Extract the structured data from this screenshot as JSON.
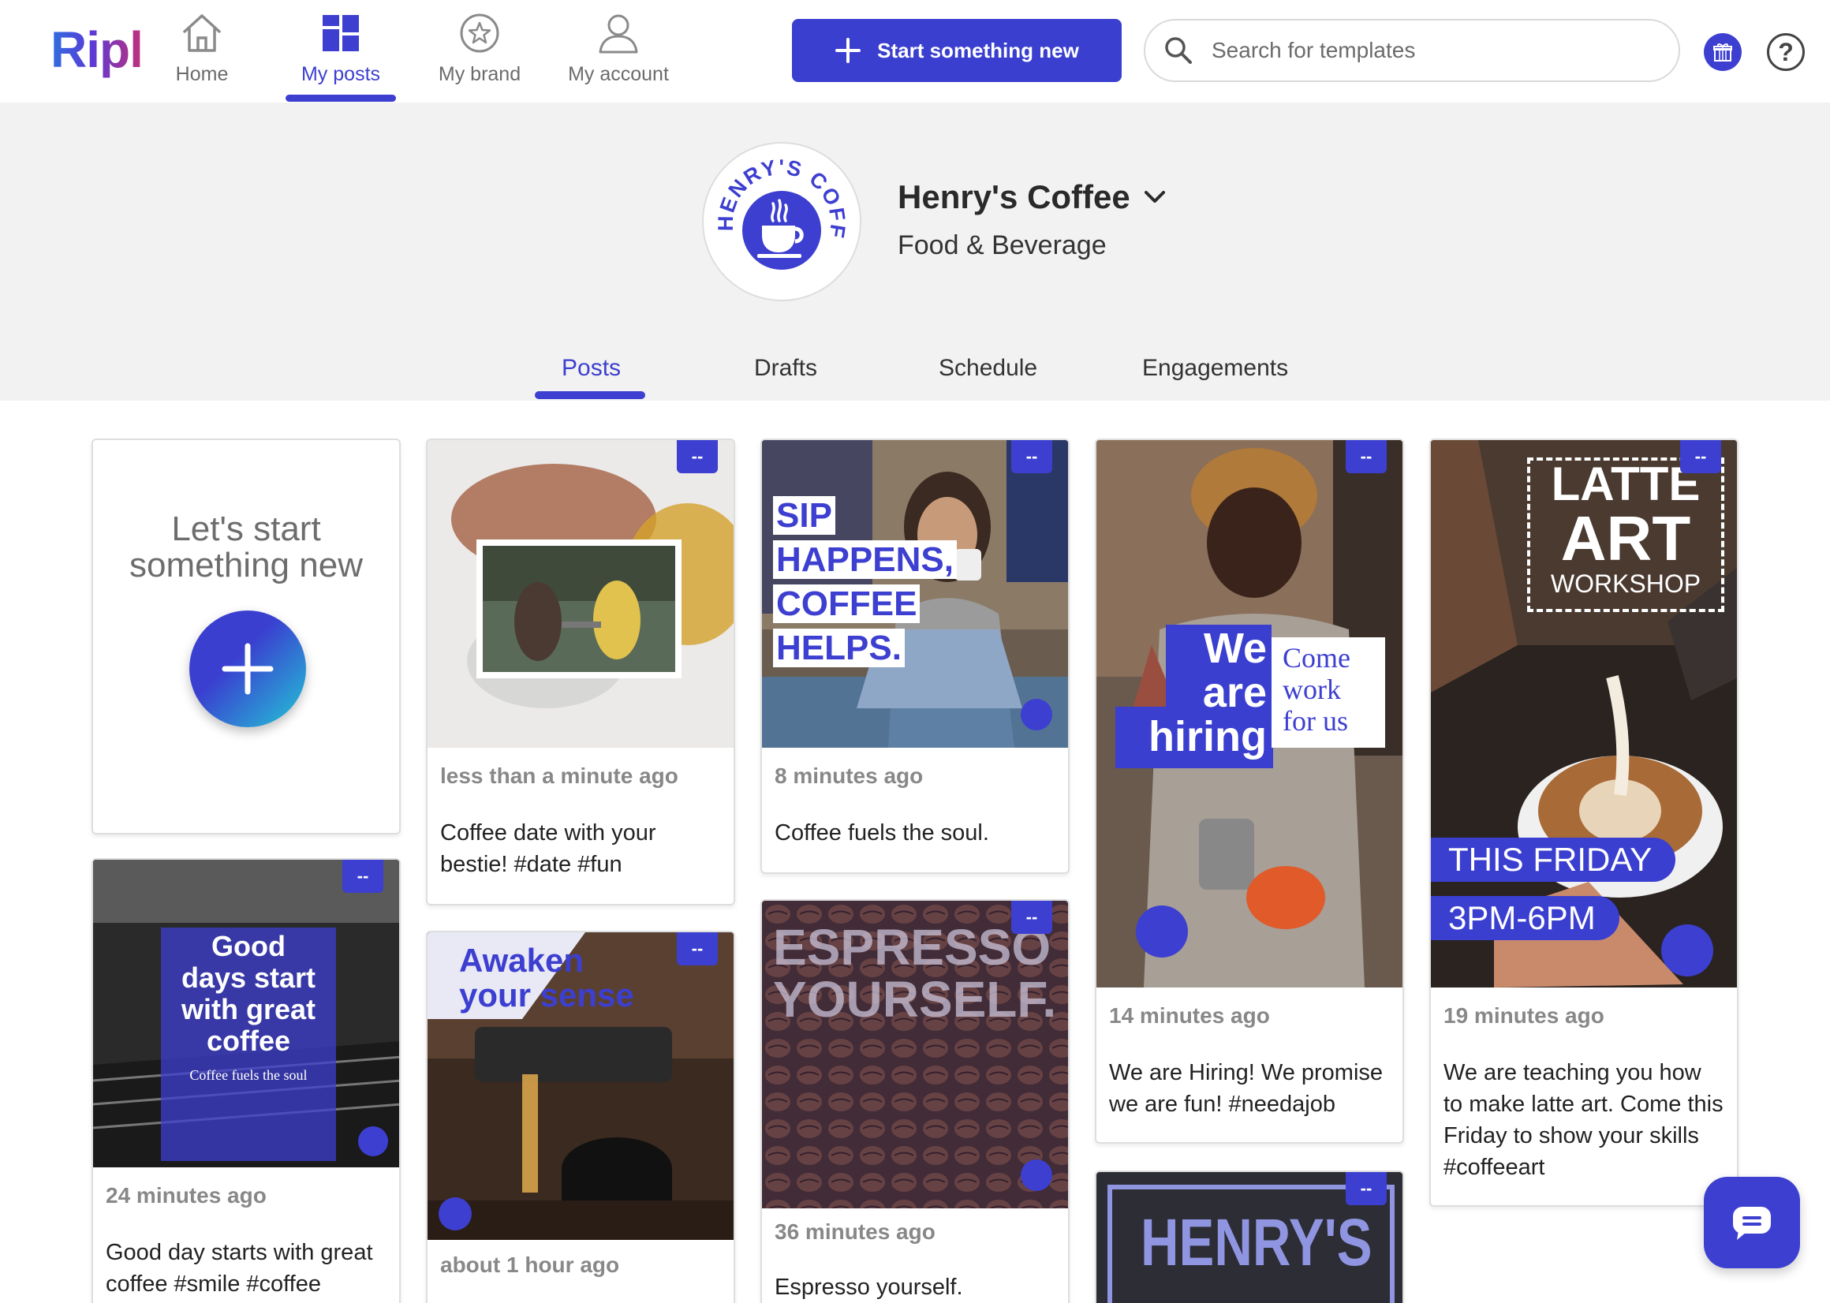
{
  "app": {
    "logo": "Ripl"
  },
  "nav": {
    "items": [
      {
        "label": "Home",
        "icon": "home-icon"
      },
      {
        "label": "My posts",
        "icon": "grid-icon",
        "active": true
      },
      {
        "label": "My brand",
        "icon": "star-icon"
      },
      {
        "label": "My account",
        "icon": "user-icon"
      }
    ],
    "cta_label": "Start something new",
    "search_placeholder": "Search for templates"
  },
  "profile": {
    "name": "Henry's Coffee",
    "category": "Food & Beverage",
    "logo_text": "HENRY'S COFFEE"
  },
  "tabs": [
    {
      "label": "Posts",
      "active": true
    },
    {
      "label": "Drafts"
    },
    {
      "label": "Schedule"
    },
    {
      "label": "Engagements"
    }
  ],
  "start_card": {
    "title_line1": "Let's start",
    "title_line2": "something new"
  },
  "badge": "--",
  "posts": [
    {
      "time": "less than a minute ago",
      "caption": "Coffee date with your bestie! #date #fun"
    },
    {
      "time": "8 minutes ago",
      "caption": "Coffee fuels the soul.",
      "overlay": [
        "SIP",
        "HAPPENS,",
        "COFFEE",
        "HELPS."
      ]
    },
    {
      "time": "14 minutes ago",
      "caption": "We are Hiring! We promise we are fun! #needajob",
      "overlay_left": [
        "We",
        "are",
        "hiring"
      ],
      "overlay_right": [
        "Come",
        "work",
        "for us"
      ]
    },
    {
      "time": "19 minutes ago",
      "caption": "We are teaching you how to make latte art. Come this Friday to show your skills #coffeeart",
      "overlay_title": [
        "LATTE",
        "ART",
        "WORKSHOP"
      ],
      "overlay_pills": [
        "THIS FRIDAY",
        "3PM-6PM"
      ]
    },
    {
      "time": "24 minutes ago",
      "caption": "Good day starts with great coffee #smile #coffee",
      "overlay": [
        "Good",
        "days start",
        "with great",
        "coffee"
      ],
      "overlay_sub": "Coffee fuels the soul"
    },
    {
      "time": "about 1 hour ago",
      "caption": "",
      "overlay": [
        "Awaken",
        "your sense"
      ]
    },
    {
      "time": "36 minutes ago",
      "caption": "Espresso yourself.",
      "overlay": [
        "ESPRESSO",
        "YOURSELF."
      ]
    },
    {
      "time": "",
      "caption": "",
      "overlay": [
        "HENRY'S"
      ]
    }
  ],
  "colors": {
    "accent": "#3d3fd0",
    "band": "#f2f2f2"
  }
}
